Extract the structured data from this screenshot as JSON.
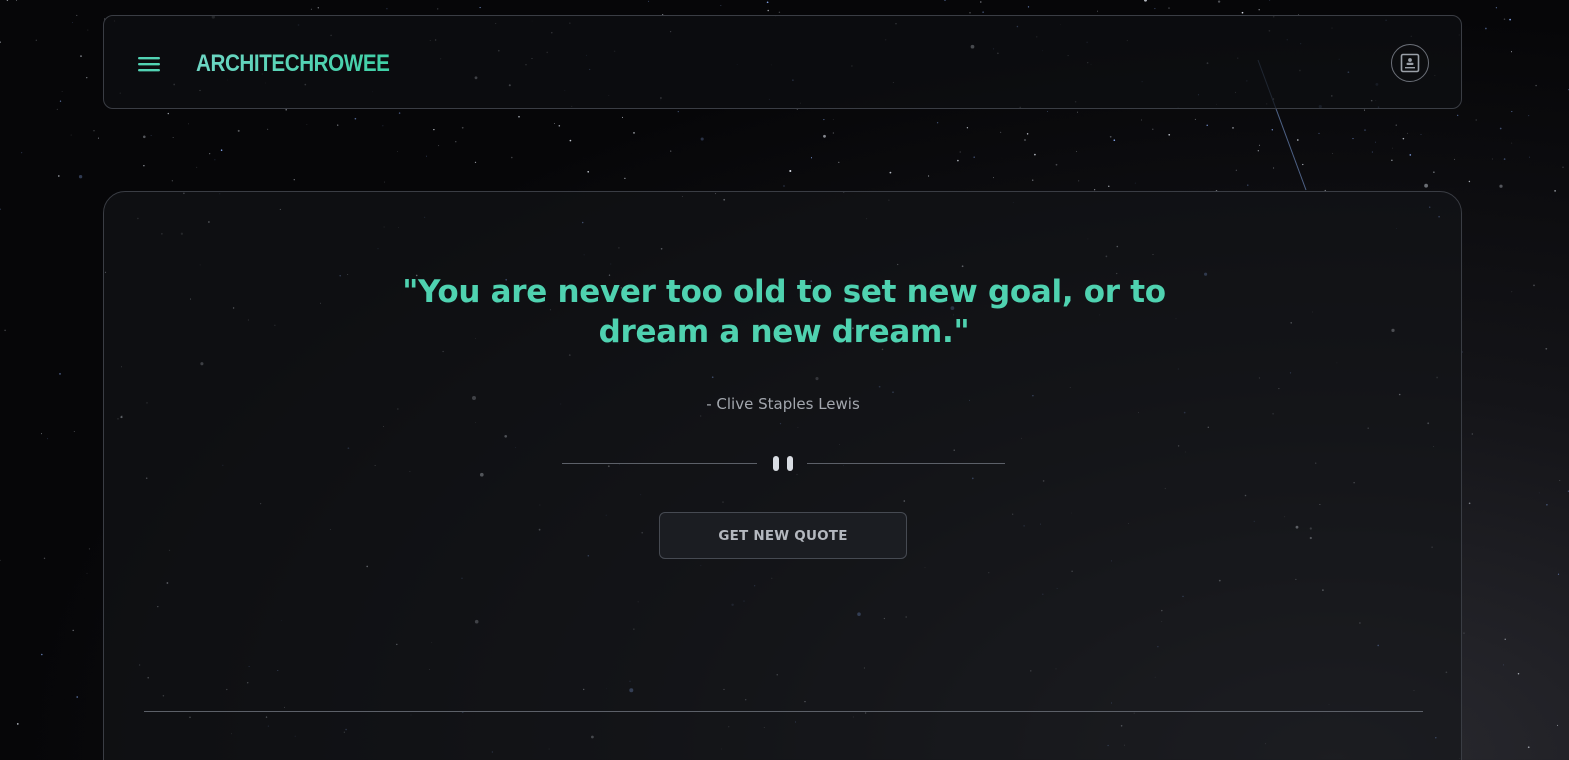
{
  "navbar": {
    "brand": "ARCHITECHROWEE",
    "menu_icon": "hamburger-menu-icon",
    "profile_icon": "contact-card-icon"
  },
  "quote": {
    "text": "\"You are never too old to set new goal, or to dream a new dream.\"",
    "author": "- Clive Staples Lewis"
  },
  "controls": {
    "pause_icon": "pause-icon",
    "new_quote_label": "GET NEW QUOTE"
  },
  "colors": {
    "accent": "#4fd2b0",
    "brand_gradient_start": "#6ed6c4",
    "brand_gradient_end": "#3fd0a6",
    "panel_border": "#3a3d44",
    "text_muted": "#a3a7ae",
    "background": "#060608"
  }
}
